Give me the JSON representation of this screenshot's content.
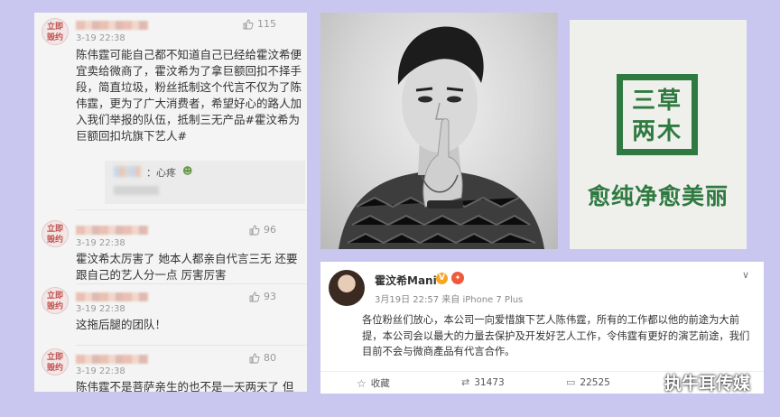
{
  "comments": [
    {
      "avatar_text_1": "立即",
      "avatar_text_2": "毁约",
      "time": "3-19 22:38",
      "likes": "115",
      "text": "陈伟霆可能自己都不知道自己已经给霍汶希便宜卖给微商了，霍汶希为了拿巨额回扣不择手段，简直垃圾，粉丝抵制这个代言不仅为了陈伟霆，更为了广大消费者，希望好心的路人加入我们举报的队伍，抵制三无产品#霍汶希为巨额回扣坑旗下艺人#",
      "reply_text": "：心疼"
    },
    {
      "avatar_text_1": "立即",
      "avatar_text_2": "毁约",
      "time": "3-19 22:38",
      "likes": "96",
      "text": "霍汶希太厉害了 她本人都亲自代言三无 还要跟自己的艺人分一点 厉害厉害"
    },
    {
      "avatar_text_1": "立即",
      "avatar_text_2": "毁约",
      "time": "3-19 22:38",
      "likes": "93",
      "text": "这拖后腿的团队！"
    },
    {
      "avatar_text_1": "立即",
      "avatar_text_2": "毁约",
      "time": "3-19 22:38",
      "likes": "80",
      "text": "陈伟霆不是菩萨亲生的也不是一天两天了 但"
    }
  ],
  "logo": {
    "line1": "三草",
    "line2": "两木",
    "slogan": "愈纯净愈美丽",
    "color": "#2f7a40"
  },
  "post": {
    "name": "霍汶希Mani",
    "verified": "V",
    "meta": "3月19日 22:57 来自 iPhone 7 Plus",
    "body": "各位粉丝们放心，本公司一向爱惜旗下艺人陈伟霆，所有的工作都以他的前途为大前提，本公司会以最大的力量去保护及开发好艺人工作，令伟霆有更好的演艺前途，我们目前不会与微商產品有代言合作。",
    "actions": {
      "collect": "收藏",
      "repost": "31473",
      "comment": "22525"
    }
  },
  "watermark": "执牛耳传媒"
}
